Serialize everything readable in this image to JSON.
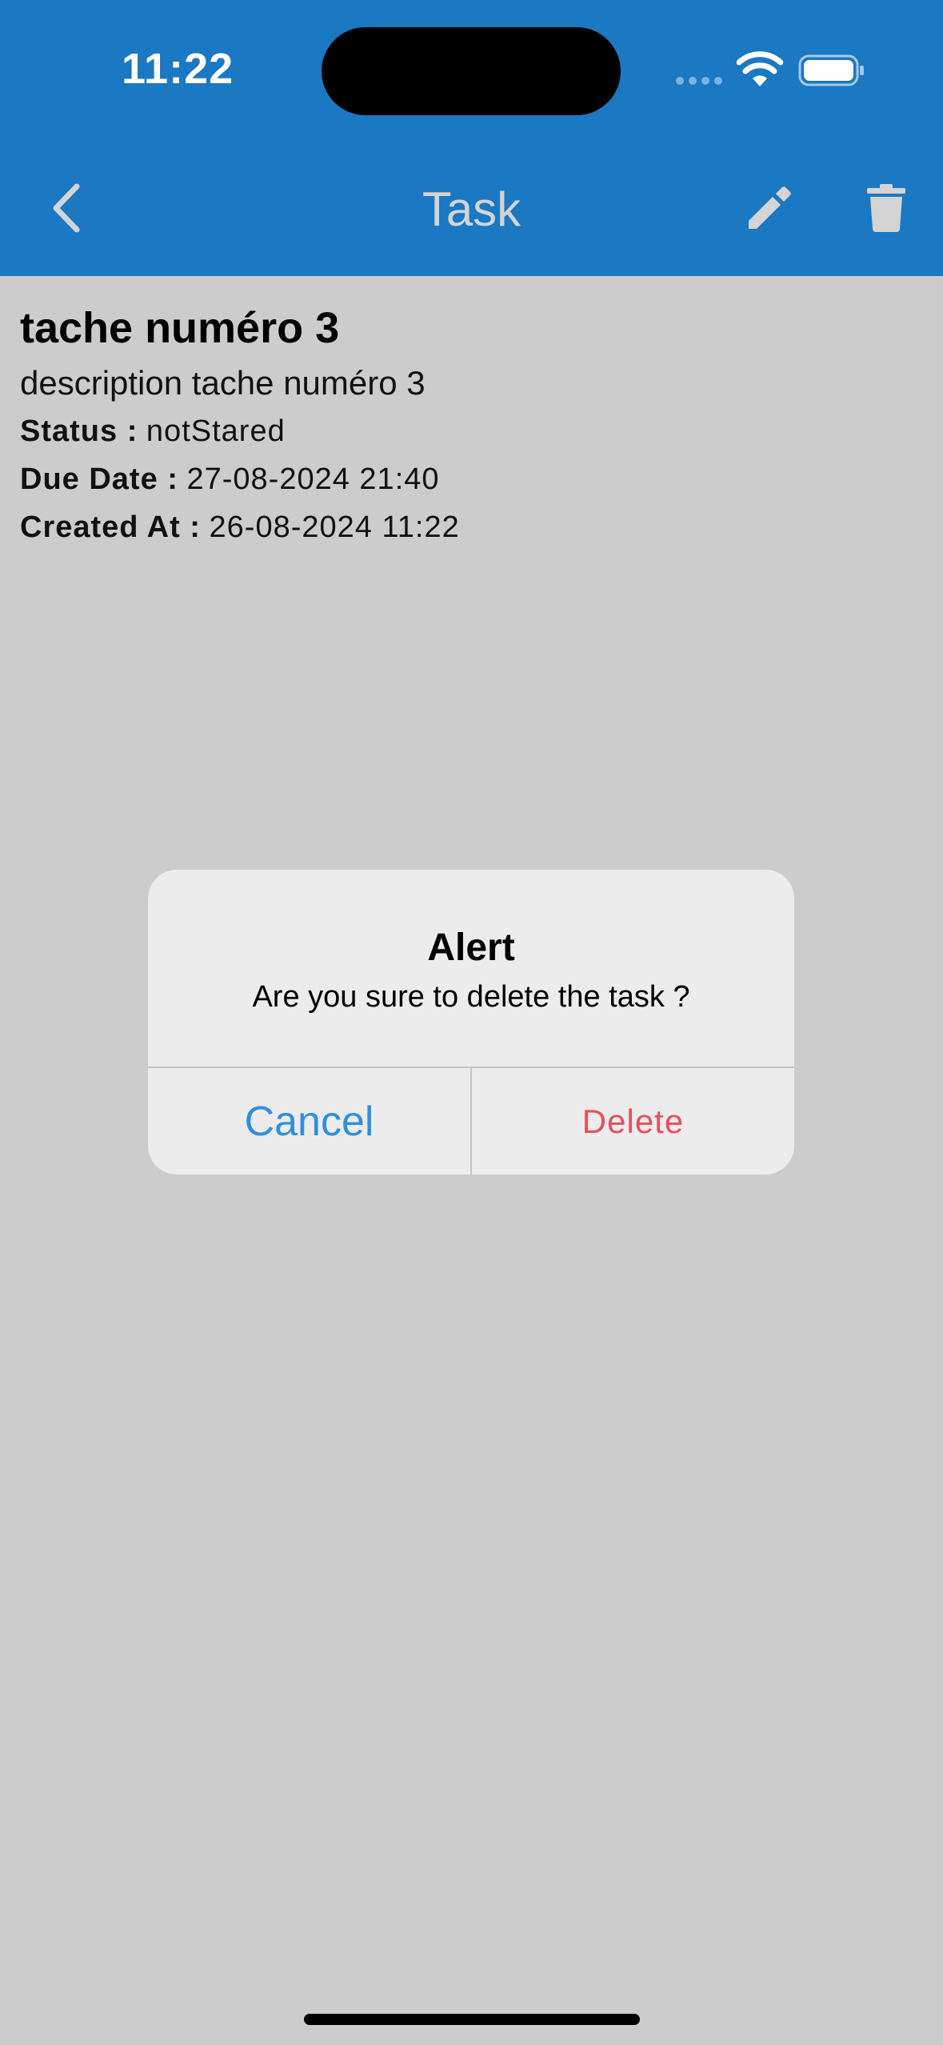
{
  "status_bar": {
    "time": "11:22"
  },
  "header": {
    "title": "Task",
    "back_icon": "chevron-left",
    "edit_icon": "pencil",
    "delete_icon": "trash",
    "background": "#1b78c2"
  },
  "task": {
    "title": "tache numéro 3",
    "description": "description tache numéro 3",
    "status_label": "Status :",
    "status_value": "notStared",
    "due_label": "Due Date :",
    "due_value": "27-08-2024 21:40",
    "created_label": "Created At :",
    "created_value": "26-08-2024 11:22"
  },
  "alert": {
    "title": "Alert",
    "message": "Are you sure to delete the task ?",
    "cancel_label": "Cancel",
    "delete_label": "Delete",
    "cancel_color": "#2f8fe0",
    "delete_color": "#e8505b"
  }
}
